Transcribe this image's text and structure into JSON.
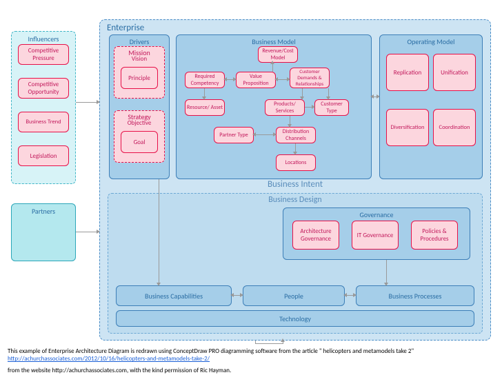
{
  "influencers": {
    "title": "Influencers",
    "items": [
      "Competitive Pressure",
      "Competitive Opportunity",
      "Business Trend",
      "Legislation"
    ]
  },
  "partners": {
    "title": "Partners"
  },
  "enterprise": {
    "title": "Enterprise"
  },
  "drivers": {
    "title": "Drivers",
    "mission": {
      "title": "Mission",
      "vision": "Vision",
      "principle": "Principle"
    },
    "strategy": {
      "title": "Strategy",
      "objective": "Objective",
      "goal": "Goal"
    }
  },
  "business_model": {
    "title": "Business Model",
    "nodes": {
      "revenue_cost": "Revenue/Cost Model",
      "required_competency": "Required Competency",
      "value_proposition": "Value Proposition",
      "customer_demands": "Customer Demands & Relationships",
      "resource_asset": "Resource/ Asset",
      "products_services": "Products/ Services",
      "customer_type": "Customer Type",
      "partner_type": "Partner Type",
      "distribution_channels": "Distribution Channels",
      "locations": "Locations"
    }
  },
  "operating_model": {
    "title": "Operating Model",
    "nodes": [
      "Replication",
      "Unification",
      "Diversification",
      "Coordination"
    ]
  },
  "sections": {
    "business_intent": "Business Intent",
    "business_design": "Business Design"
  },
  "governance": {
    "title": "Governance",
    "nodes": [
      "Architecture Governance",
      "IT Governance",
      "Policies & Procedures"
    ]
  },
  "bottom_row": {
    "capabilities": "Business Capabilities",
    "people": "People",
    "processes": "Business Processes",
    "technology": "Technology"
  },
  "caption": {
    "line1_a": "This example of Enterprise Architecture Diagram is redrawn using ConceptDraw PRO diagramming software  from the article \" helicopters and metamodels take 2\"",
    "link": "http://achurchassociates.com/2012/10/16/helicopters-and-metamodels-take-2/",
    "line2": "from the website http://achurchassociates.com,  with the kind permission of Ric Hayman."
  }
}
